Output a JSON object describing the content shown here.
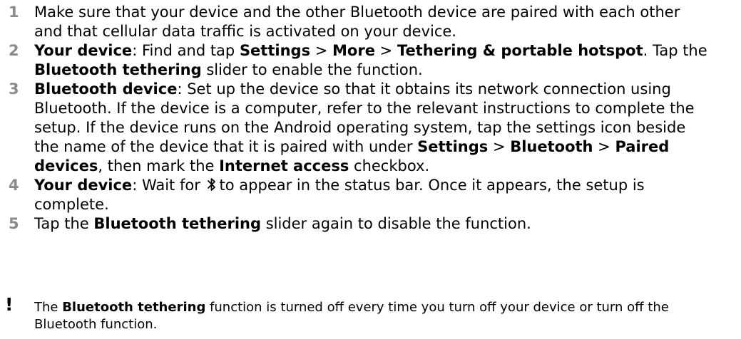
{
  "steps": [
    {
      "number": "1",
      "segments": [
        {
          "text": "Make sure that your device and the other Bluetooth device are paired with each other and that cellular data traffic is activated on your device.",
          "bold": false
        }
      ]
    },
    {
      "number": "2",
      "segments": [
        {
          "text": "Your device",
          "bold": true
        },
        {
          "text": ": Find and tap ",
          "bold": false
        },
        {
          "text": "Settings",
          "bold": true
        },
        {
          "text": " > ",
          "bold": false
        },
        {
          "text": "More",
          "bold": true
        },
        {
          "text": " > ",
          "bold": false
        },
        {
          "text": "Tethering & portable hotspot",
          "bold": true
        },
        {
          "text": ". Tap the ",
          "bold": false
        },
        {
          "text": "Bluetooth tethering",
          "bold": true
        },
        {
          "text": " slider to enable the function.",
          "bold": false
        }
      ]
    },
    {
      "number": "3",
      "segments": [
        {
          "text": "Bluetooth device",
          "bold": true
        },
        {
          "text": ": Set up the device so that it obtains its network connection using Bluetooth. If the device is a computer, refer to the relevant instructions to complete the setup. If the device runs on the Android operating system, tap the settings icon beside the name of the device that it is paired with under ",
          "bold": false
        },
        {
          "text": "Settings",
          "bold": true
        },
        {
          "text": " > ",
          "bold": false
        },
        {
          "text": "Bluetooth",
          "bold": true
        },
        {
          "text": " > ",
          "bold": false
        },
        {
          "text": "Paired devices",
          "bold": true
        },
        {
          "text": ", then mark the ",
          "bold": false
        },
        {
          "text": "Internet access",
          "bold": true
        },
        {
          "text": " checkbox.",
          "bold": false
        }
      ]
    },
    {
      "number": "4",
      "segments": [
        {
          "text": "Your device",
          "bold": true
        },
        {
          "text": ": Wait for ",
          "bold": false
        },
        {
          "icon": "bluetooth-icon"
        },
        {
          "text": "to appear in the status bar. Once it appears, the setup is complete.",
          "bold": false
        }
      ]
    },
    {
      "number": "5",
      "segments": [
        {
          "text": "Tap the ",
          "bold": false
        },
        {
          "text": "Bluetooth tethering",
          "bold": true
        },
        {
          "text": " slider again to disable the function.",
          "bold": false
        }
      ]
    }
  ],
  "note": {
    "mark": "!",
    "segments": [
      {
        "text": "The ",
        "bold": false
      },
      {
        "text": "Bluetooth tethering",
        "bold": true
      },
      {
        "text": " function is turned off every time you turn off your device or turn off the Bluetooth function.",
        "bold": false
      }
    ]
  },
  "colors": {
    "step_number": "#8a8a8a",
    "text": "#000000",
    "background": "#ffffff"
  }
}
